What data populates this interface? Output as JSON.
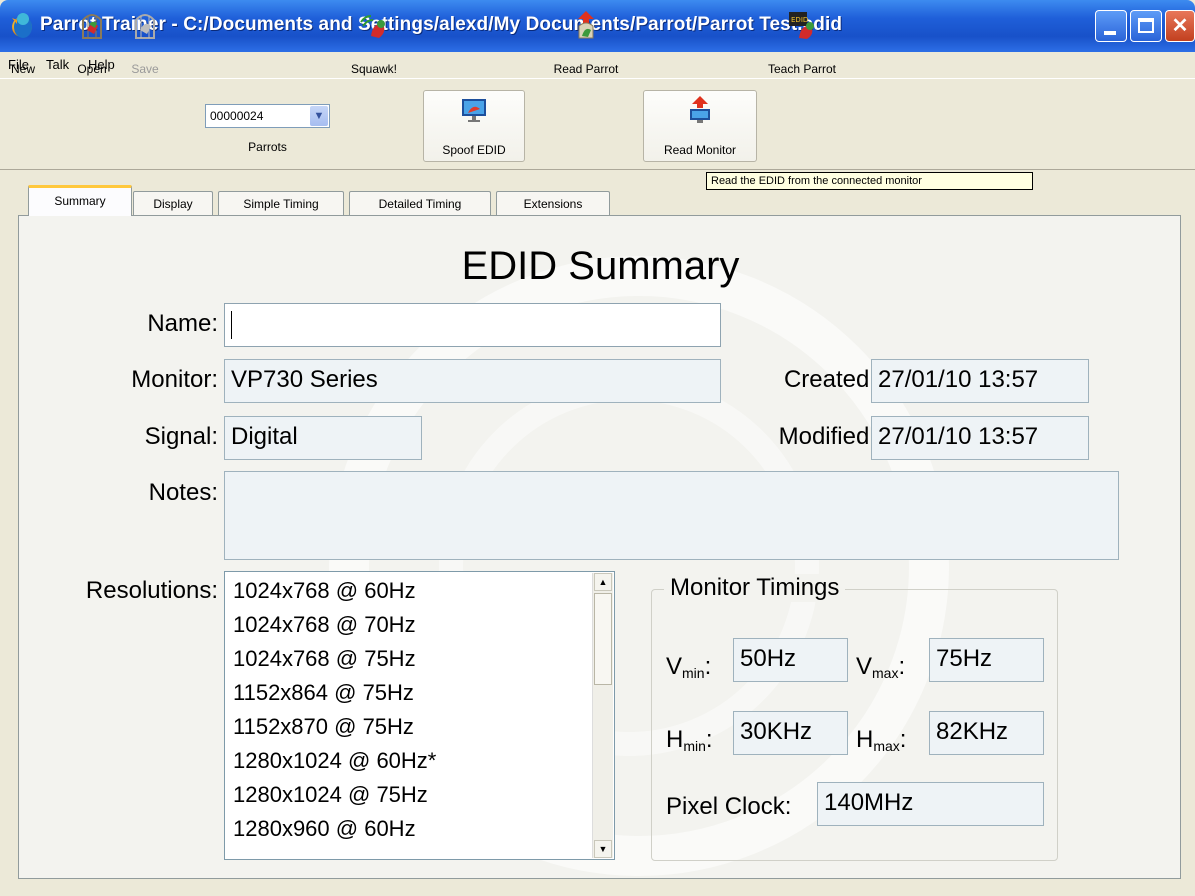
{
  "window": {
    "title": "Parrot Trainer - C:/Documents and Settings/alexd/My Documents/Parrot/Parrot Test.edid"
  },
  "menu": [
    "File",
    "Talk",
    "Help"
  ],
  "toolbar": {
    "new": "New",
    "open": "Open",
    "save": "Save",
    "parrots_value": "00000024",
    "parrots": "Parrots",
    "squawk": "Squawk!",
    "spoof": "Spoof EDID",
    "read_parrot": "Read Parrot",
    "read_monitor": "Read Monitor",
    "teach_parrot": "Teach Parrot"
  },
  "tooltip": "Read the EDID from the connected monitor",
  "tabs": [
    "Summary",
    "Display",
    "Simple Timing",
    "Detailed Timing",
    "Extensions"
  ],
  "summary": {
    "heading": "EDID Summary",
    "name_label": "Name:",
    "name_value": "",
    "monitor_label": "Monitor:",
    "monitor_value": "VP730 Series",
    "signal_label": "Signal:",
    "signal_value": "Digital",
    "notes_label": "Notes:",
    "notes_value": "",
    "created_label": "Created:",
    "created_value": "27/01/10 13:57",
    "modified_label": "Modified:",
    "modified_value": "27/01/10 13:57",
    "resolutions_label": "Resolutions:",
    "resolutions": [
      "1024x768 @ 60Hz",
      "1024x768 @ 70Hz",
      "1024x768 @ 75Hz",
      "1152x864 @ 75Hz",
      "1152x870 @ 75Hz",
      "1280x1024 @ 60Hz*",
      "1280x1024 @ 75Hz",
      "1280x960 @ 60Hz"
    ]
  },
  "timings": {
    "title": "Monitor Timings",
    "v": "V",
    "h": "H",
    "min": "min",
    "max": "max",
    "colon": ":",
    "vmin": "50Hz",
    "vmax": "75Hz",
    "hmin": "30KHz",
    "hmax": "82KHz",
    "pixel_clock_label": "Pixel Clock:",
    "pixel_clock": "140MHz"
  },
  "colors": {
    "titlebar": "#1f5fd9",
    "tab_active_accent": "#ffc83c",
    "tooltip_bg": "#ffffe1"
  }
}
